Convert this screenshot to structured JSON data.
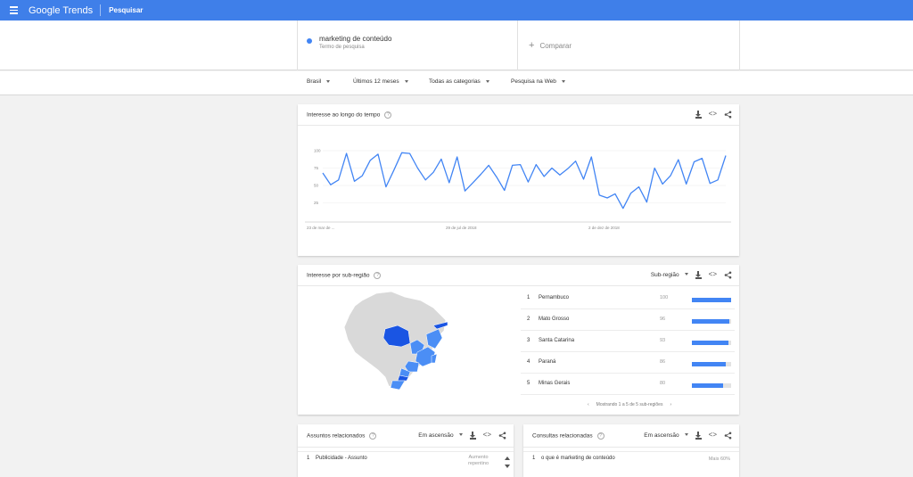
{
  "header": {
    "logo": "Google Trends",
    "page": "Pesquisar"
  },
  "term": {
    "name": "marketing de conteúdo",
    "subtitle": "Termo de pesquisa",
    "compare_label": "Comparar",
    "color": "#4285f4"
  },
  "filters": [
    {
      "label": "Brasil"
    },
    {
      "label": "Últimos 12 meses"
    },
    {
      "label": "Todas as categorias"
    },
    {
      "label": "Pesquisa na Web"
    }
  ],
  "interest_over_time": {
    "title": "Interesse ao longo do tempo",
    "help": "?",
    "embed_icon": "<>",
    "share_icon": "share-icon",
    "download_icon": "download-icon"
  },
  "chart_data": {
    "type": "line",
    "title": "",
    "xlabel": "",
    "ylabel": "",
    "y_ticks": [
      "100",
      "75",
      "50",
      "25"
    ],
    "ylim": [
      0,
      100
    ],
    "grid": true,
    "x_tick_labels": [
      "23 de mar de ...",
      "29 de jul de 2018",
      "2 de dez de 2018"
    ],
    "series": [
      {
        "color": "#4285f4",
        "values": [
          68,
          51,
          58,
          96,
          56,
          64,
          86,
          95,
          48,
          72,
          97,
          96,
          75,
          58,
          69,
          88,
          54,
          91,
          42,
          54,
          66,
          79,
          62,
          43,
          79,
          80,
          55,
          80,
          63,
          75,
          65,
          74,
          85,
          59,
          91,
          36,
          32,
          38,
          17,
          39,
          48,
          26,
          75,
          52,
          64,
          87,
          52,
          84,
          89,
          53,
          58,
          93
        ]
      }
    ]
  },
  "subregion": {
    "title": "Interesse por sub-região",
    "help": "?",
    "dropdown": "Sub-região",
    "embed_icon": "<>",
    "regions": [
      {
        "rank": "1",
        "name": "Pernambuco",
        "value": "100",
        "fill": 1.0
      },
      {
        "rank": "2",
        "name": "Mato Grosso",
        "value": "96",
        "fill": 0.96
      },
      {
        "rank": "3",
        "name": "Santa Catarina",
        "value": "93",
        "fill": 0.93
      },
      {
        "rank": "4",
        "name": "Paraná",
        "value": "86",
        "fill": 0.86
      },
      {
        "rank": "5",
        "name": "Minas Gerais",
        "value": "80",
        "fill": 0.8
      }
    ],
    "pager_text": "Mostrando 1 a 5 de 5 sub-regiões",
    "map_colors": {
      "high": "#1a55e3",
      "mid": "#4b8ef5",
      "none": "#d9d9d9"
    }
  },
  "related_topics": {
    "title": "Assuntos relacionados",
    "help": "?",
    "dropdown": "Em ascensão",
    "embed_icon": "<>",
    "items": [
      {
        "rank": "1",
        "name": "Publicidade - Assunto",
        "badge_line1": "Aumento",
        "badge_line2": "repentino"
      }
    ]
  },
  "related_queries": {
    "title": "Consultas relacionadas",
    "help": "?",
    "dropdown": "Em ascensão",
    "embed_icon": "<>",
    "items": [
      {
        "rank": "1",
        "name": "o que é marketing de conteúdo",
        "badge": "Mais 60%"
      }
    ]
  }
}
